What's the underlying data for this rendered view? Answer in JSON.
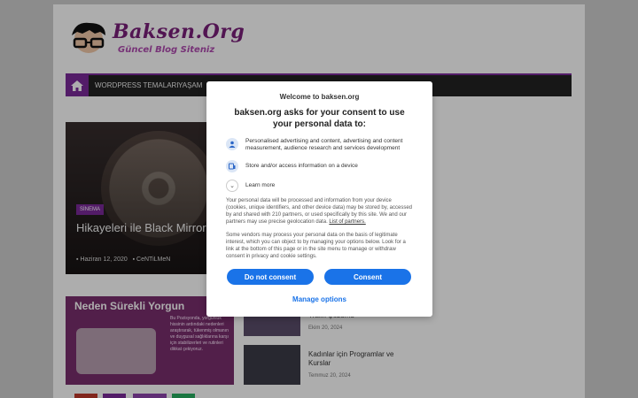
{
  "site": {
    "logo_title": "Baksen.Org",
    "logo_subtitle": "Güncel Blog Siteniz"
  },
  "nav": {
    "items": [
      "WORDPRESS TEMALARI",
      "YAŞAM"
    ]
  },
  "hero": {
    "category": "SİNEMA",
    "title": "Hikayeleri ile Black Mirror 20 film!",
    "date": "Haziran 12, 2020",
    "author": "CeNTiLMeN"
  },
  "promo": {
    "title": "Neden Sürekli Yorgun",
    "text": "Bu Pozisyonda, yorgunluk hissinin ardındaki nedenleri araştırarak, tükenmiş olmanın ve duygusal sağlıklarına karşı için stabilizerleri ve rutinleri dikkat çekiyoruz."
  },
  "sidebar_posts": [
    {
      "title": "Trafik Çözümü",
      "date": "Ekim 20, 2024"
    },
    {
      "title": "Kadınlar için Programlar ve Kurslar",
      "date": "Temmuz 20, 2024"
    }
  ],
  "consent": {
    "welcome": "Welcome to baksen.org",
    "heading": "baksen.org asks for your consent to use your personal data to:",
    "purpose_1": "Personalised advertising and content, advertising and content measurement, audience research and services development",
    "purpose_2": "Store and/or access information on a device",
    "learn_more": "Learn more",
    "para_1": "Your personal data will be processed and information from your device (cookies, unique identifiers, and other device data) may be stored by, accessed by and shared with 210 partners, or used specifically by this site. We and our partners may use precise geolocation data.",
    "partners_link": "List of partners.",
    "para_2": "Some vendors may process your personal data on the basis of legitimate interest, which you can object to by managing your options below. Look for a link at the bottom of this page or in the site menu to manage or withdraw consent in privacy and cookie settings.",
    "btn_reject": "Do not consent",
    "btn_accept": "Consent",
    "manage": "Manage options"
  },
  "colors": {
    "brand": "#7b2a9a",
    "accent": "#1a73e8"
  }
}
